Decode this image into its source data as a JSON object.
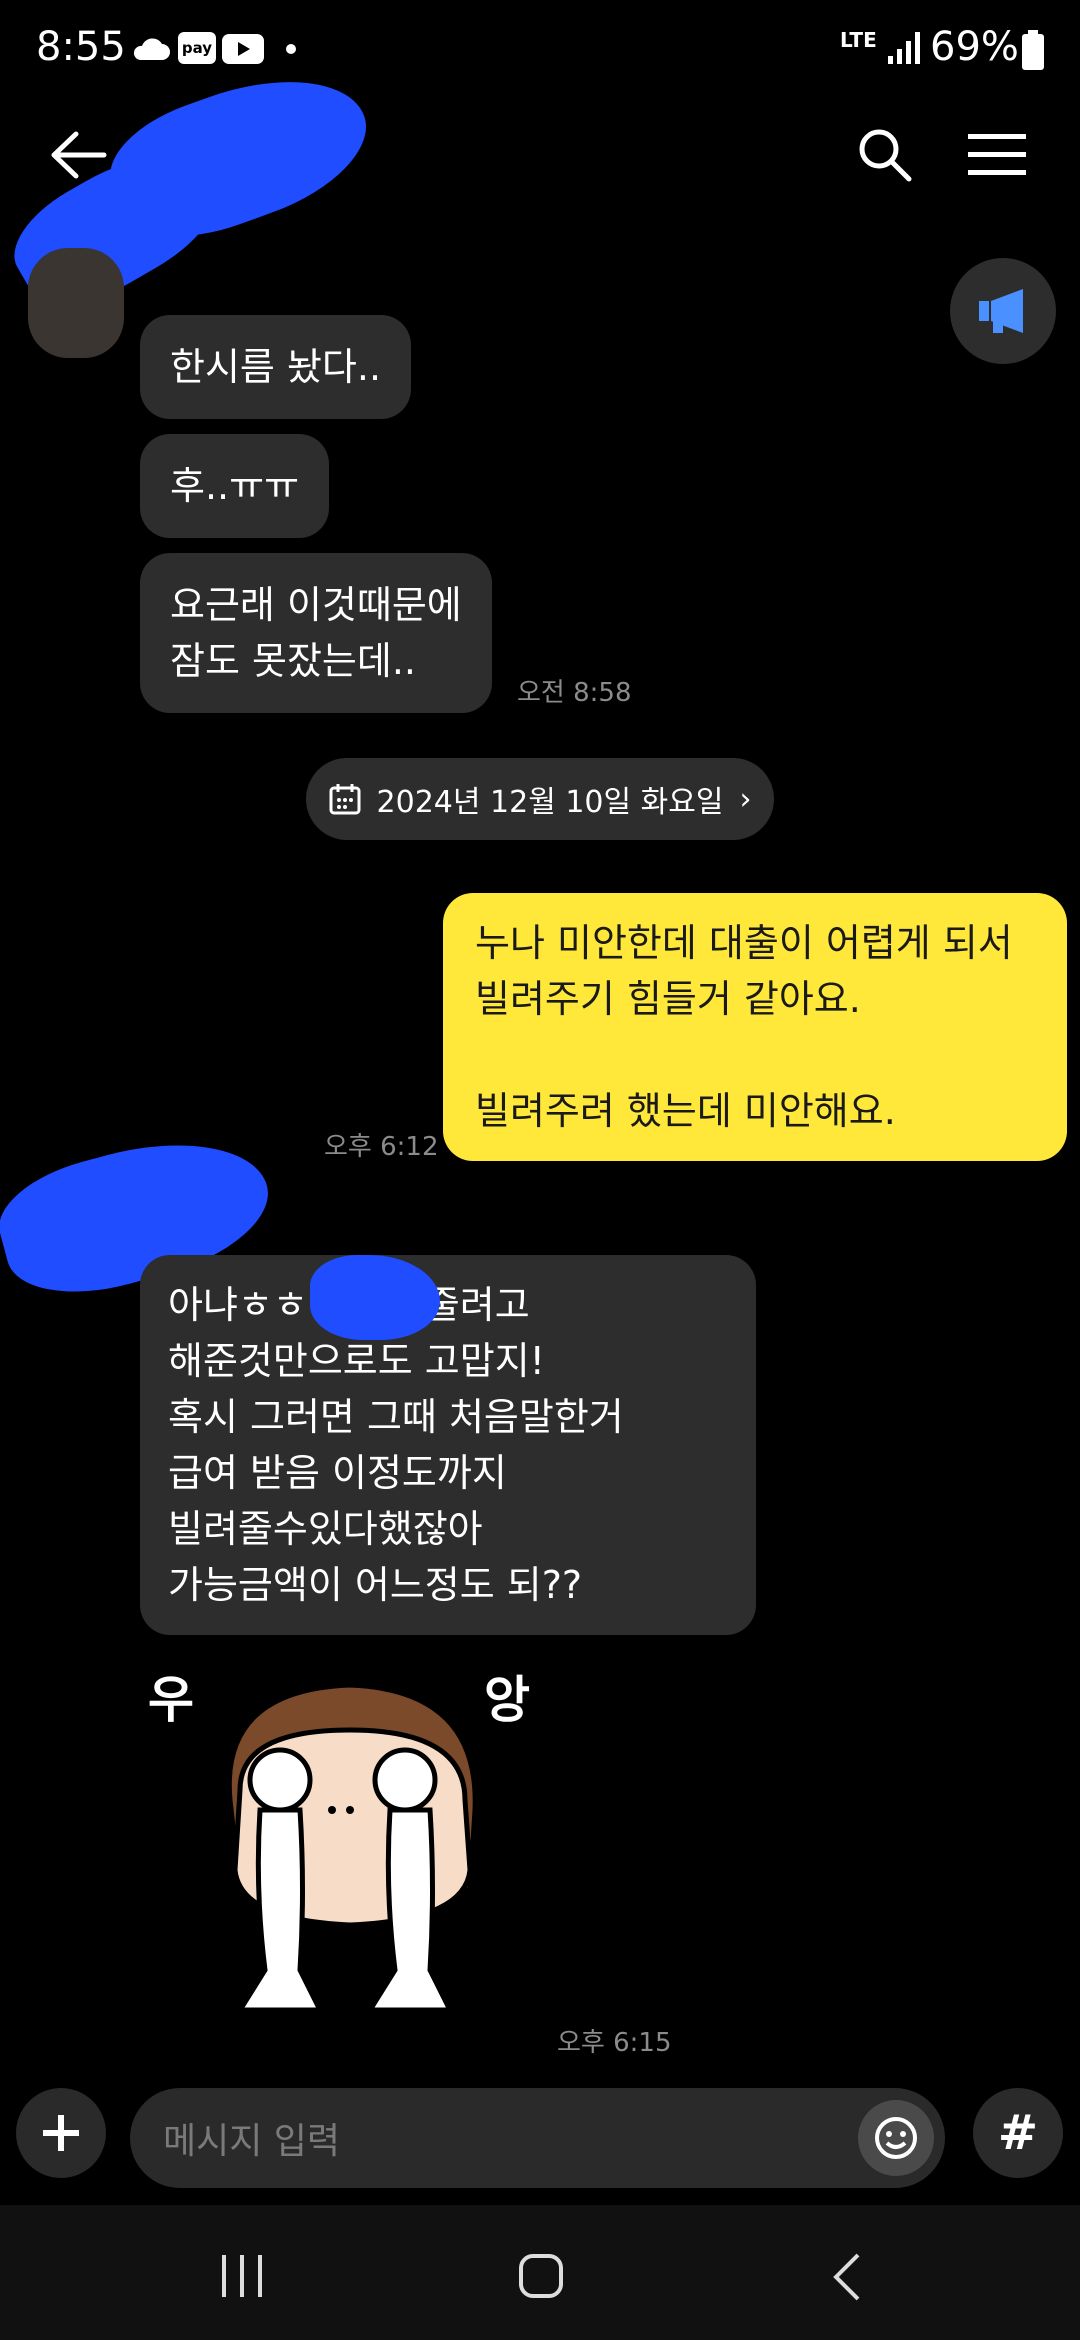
{
  "status_bar": {
    "time": "8:55",
    "pay_badge": "pay",
    "network": "LTE",
    "battery": "69%"
  },
  "header": {
    "icons": [
      "back-arrow-icon",
      "search-icon",
      "menu-icon",
      "megaphone-icon"
    ]
  },
  "messages": [
    {
      "text": "한시름 놨다.."
    },
    {
      "text": "후..ㅠㅠ"
    },
    {
      "text": "요근래 이것때문에\n잠도 못잤는데.."
    },
    {
      "time": "오전 8:58"
    }
  ],
  "date_divider": "2024년 12월 10일 화요일",
  "outgoing": {
    "text": "누나 미안한데 대출이 어렵게 되서\n빌려주기 힘들거 같아요.\n\n빌려주려 했는데 미안해요.",
    "time": "오후 6:12"
  },
  "incoming2": {
    "text": "아냐ㅎㅎ           알아봐줄려고\n해준것만으로도 고맙지!\n혹시 그러면 그때 처음말한거\n급여 받음 이정도까지\n빌려줄수있다했잖아\n가능금액이 어느정도 되??",
    "sticker_left": "우",
    "sticker_right": "앙",
    "sticker_time": "오후 6:15"
  },
  "input": {
    "placeholder": "메시지 입력",
    "hash": "#"
  }
}
